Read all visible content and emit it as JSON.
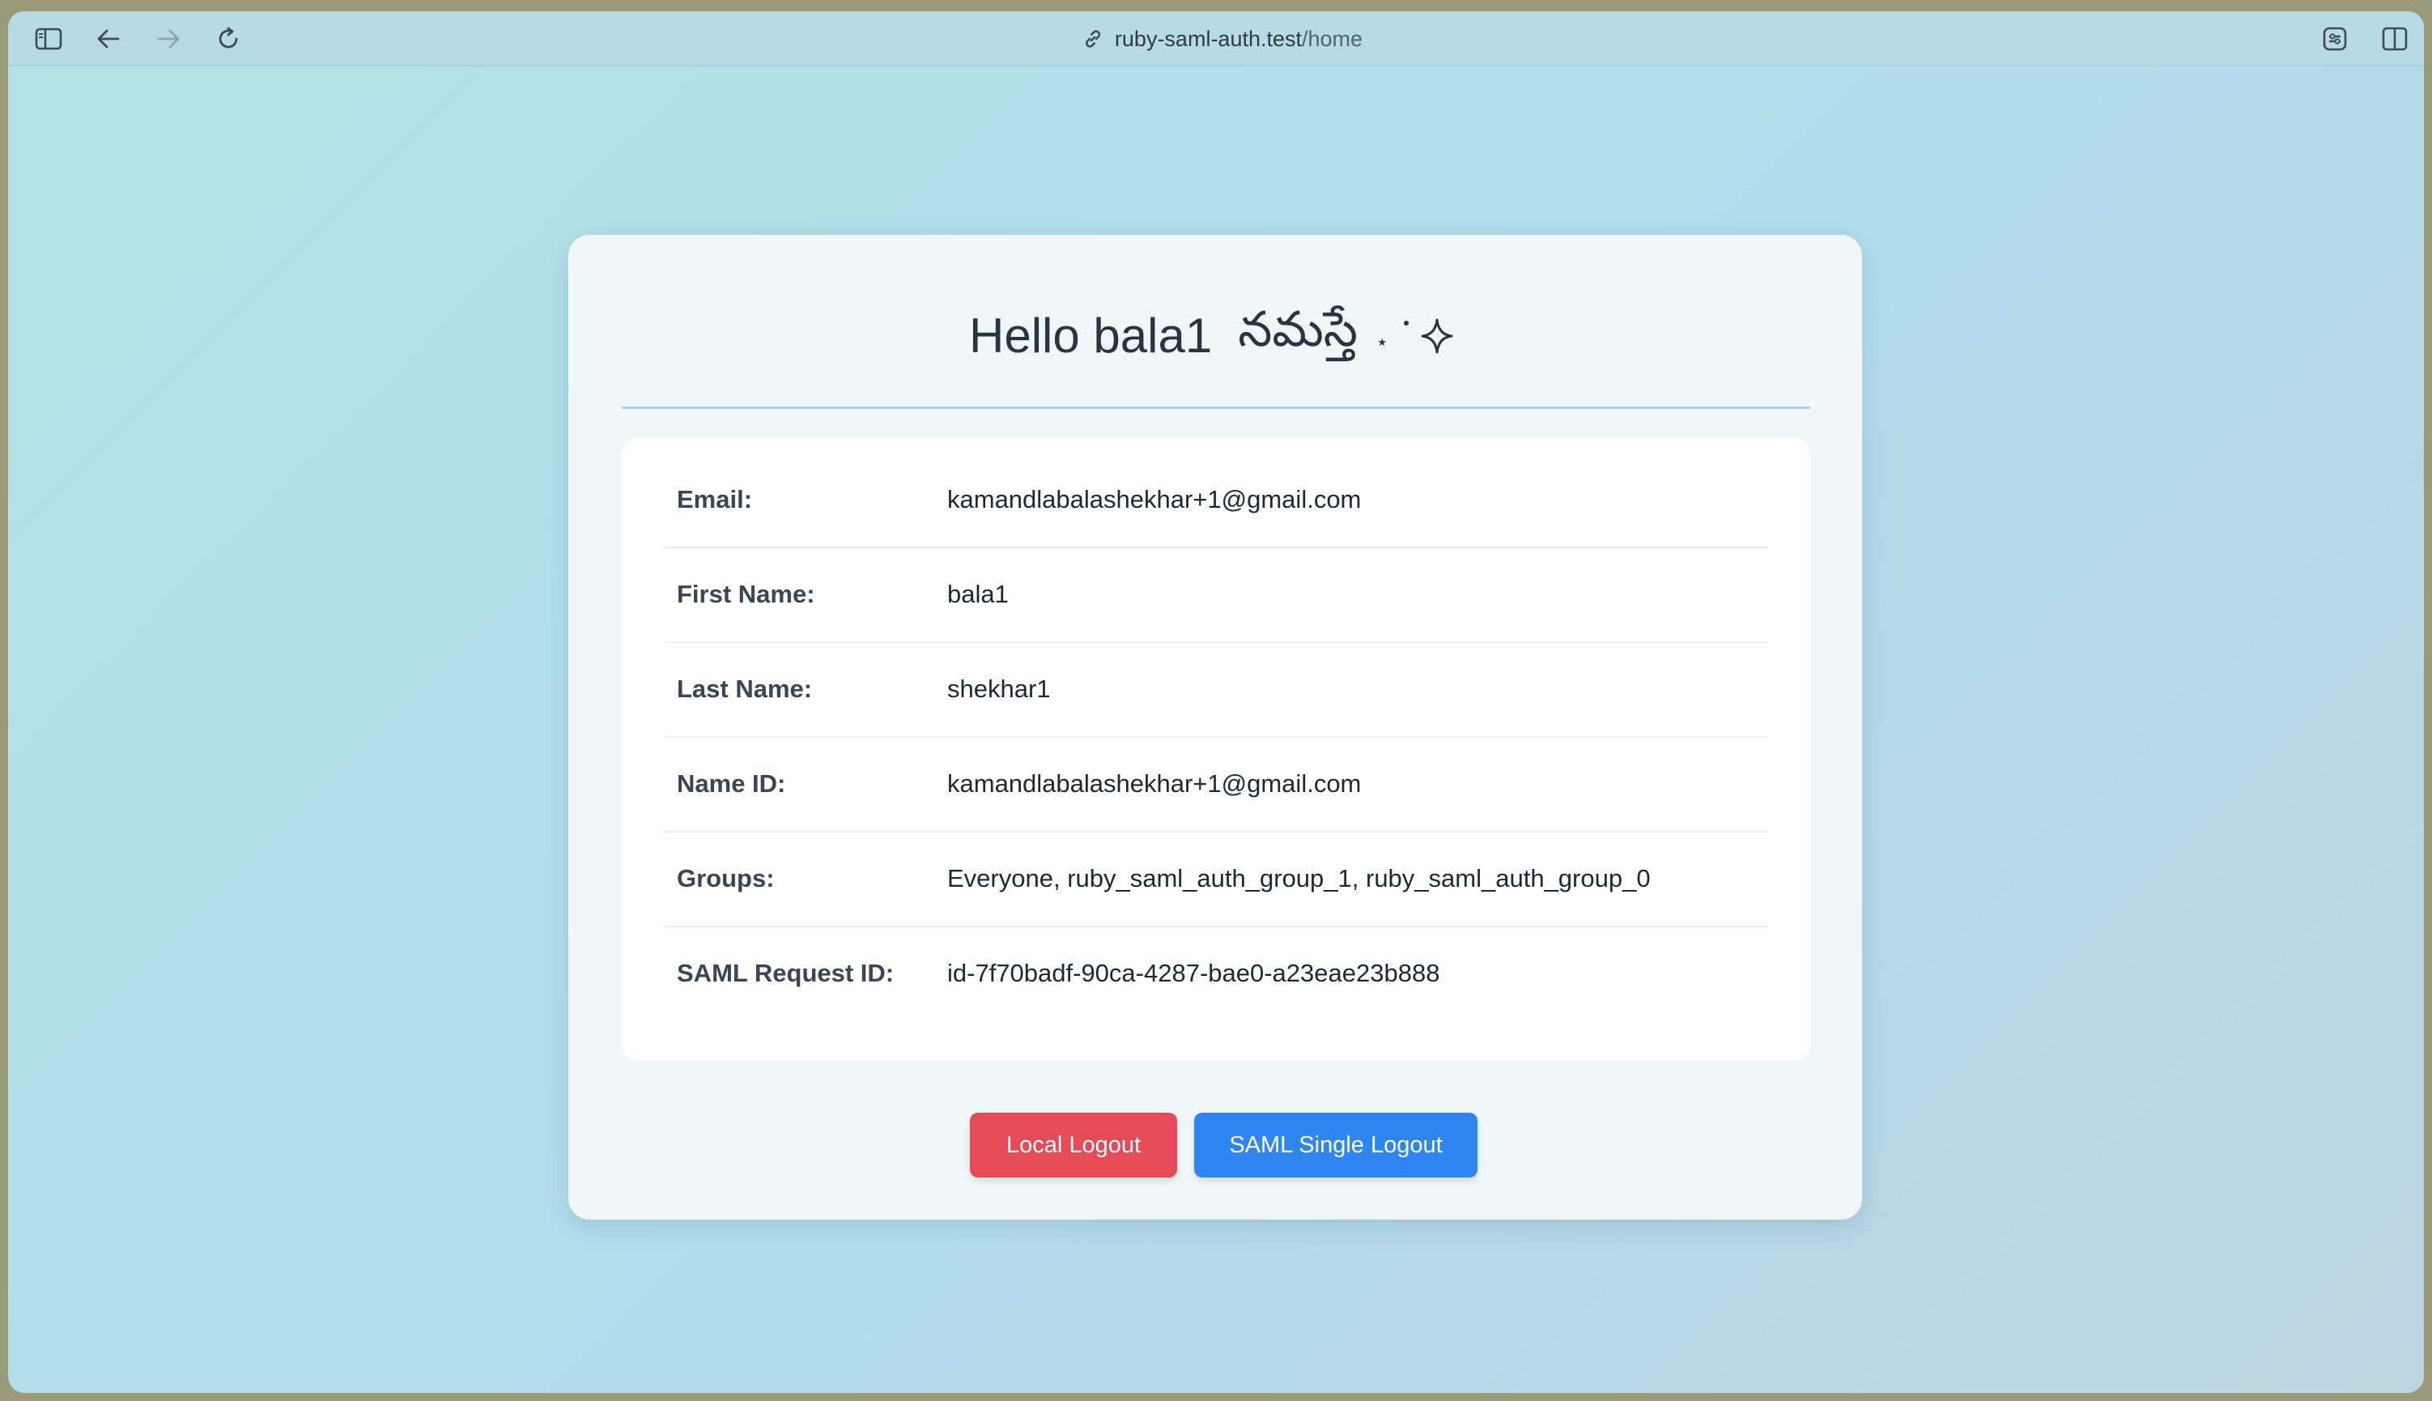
{
  "browser": {
    "url_host": "ruby-saml-auth.test",
    "url_path": "/home"
  },
  "card": {
    "greeting": "Hello bala1",
    "telugu_greeting": "నమస్తే",
    "fields": [
      {
        "label": "Email:",
        "value": "kamandlabalashekhar+1@gmail.com"
      },
      {
        "label": "First Name:",
        "value": "bala1"
      },
      {
        "label": "Last Name:",
        "value": "shekhar1"
      },
      {
        "label": "Name ID:",
        "value": "kamandlabalashekhar+1@gmail.com"
      },
      {
        "label": "Groups:",
        "value": "Everyone, ruby_saml_auth_group_1, ruby_saml_auth_group_0"
      },
      {
        "label": "SAML Request ID:",
        "value": "id-7f70badf-90ca-4287-bae0-a23eae23b888"
      }
    ],
    "local_logout_label": "Local Logout",
    "saml_logout_label": "SAML Single Logout"
  },
  "colors": {
    "local_logout": "#e54a56",
    "saml_logout": "#2e86f5",
    "background": "#b2dcec"
  }
}
